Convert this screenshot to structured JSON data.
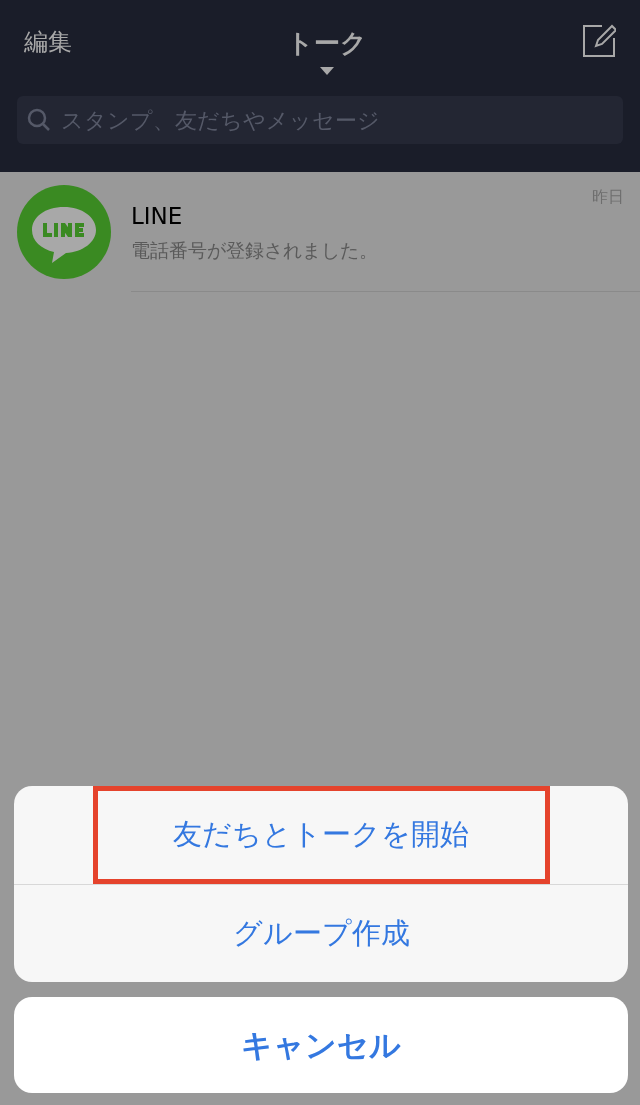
{
  "header": {
    "edit": "編集",
    "title": "トーク",
    "search": {
      "placeholder": "スタンプ、友だちやメッセージ"
    }
  },
  "chats": [
    {
      "name": "LINE",
      "message": "電話番号が登録されました。",
      "time": "昨日"
    }
  ],
  "action_sheet": {
    "options": [
      {
        "label": "友だちとトークを開始",
        "highlighted": true
      },
      {
        "label": "グループ作成",
        "highlighted": false
      }
    ],
    "cancel": "キャンセル"
  }
}
